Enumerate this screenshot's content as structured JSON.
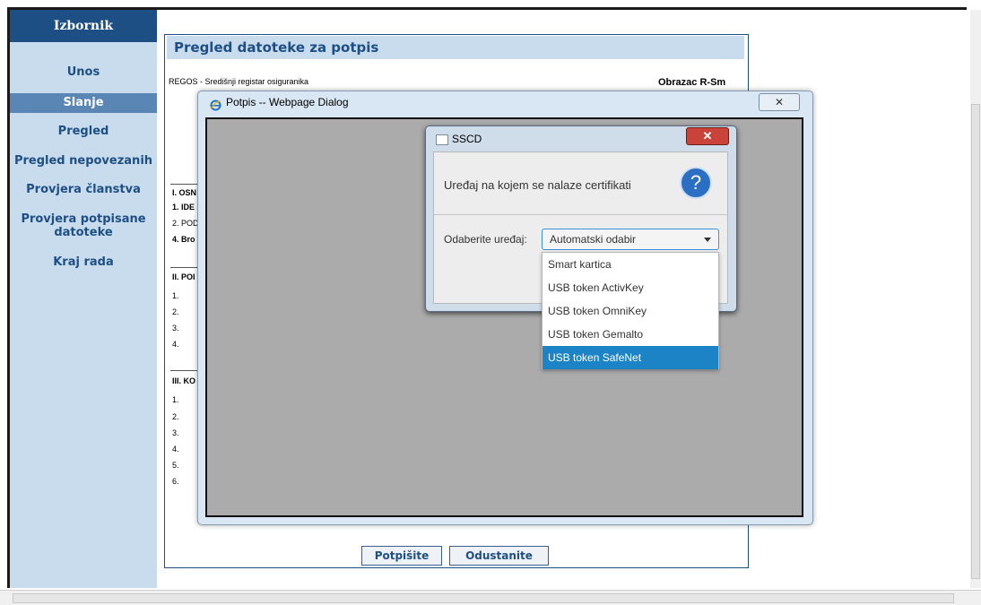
{
  "sidebar": {
    "header": "Izbornik",
    "items": [
      {
        "label": "Unos"
      },
      {
        "label": "Slanje"
      },
      {
        "label": "Pregled"
      },
      {
        "label": "Pregled nepovezanih"
      },
      {
        "label": "Provjera članstva"
      },
      {
        "label": "Provjera potpisane datoteke"
      },
      {
        "label": "Kraj rada"
      }
    ],
    "active_item": "Slanje"
  },
  "main": {
    "title": "Pregled datoteke za potpis",
    "regos_text": "REGOS - Središnji registar osiguranika",
    "form_label": "Obrazac R-Sm",
    "sections": {
      "s1": "I. OSN",
      "s1_lines": [
        "1. IDE",
        "2. POD",
        "4. Bro"
      ],
      "s2": "II. POI",
      "s2_lines": [
        "1.",
        "2.",
        "3.",
        "4."
      ],
      "s3": "III. KO",
      "s3_lines": [
        "1.",
        "2.",
        "3.",
        "4.",
        "5.",
        "6."
      ]
    },
    "buttons": {
      "sign": "Potpišite",
      "cancel": "Odustanite"
    }
  },
  "webpage_dialog": {
    "title": "Potpis -- Webpage Dialog",
    "close": "✕"
  },
  "sscd_dialog": {
    "title": "SSCD",
    "close": "✕",
    "header_text": "Uređaj na kojem se nalaze certifikati",
    "help_glyph": "?",
    "device_label": "Odaberite uređaj:",
    "selected_value": "Automatski odabir",
    "options": [
      "Smart kartica",
      "USB token ActivKey",
      "USB token OmniKey",
      "USB token Gemalto",
      "USB token SafeNet"
    ],
    "highlighted_option": "USB token SafeNet"
  },
  "colors": {
    "menu_header": "#1d4f85",
    "menu_bg": "#c9dcee",
    "highlight": "#1c84c6",
    "close_red": "#c9433b"
  }
}
